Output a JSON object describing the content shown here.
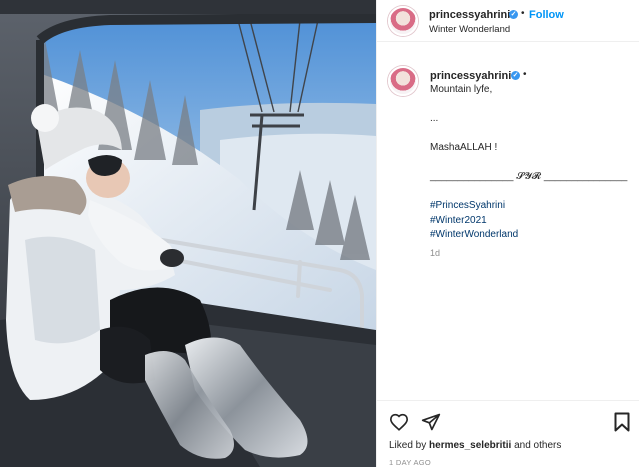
{
  "post": {
    "username": "princessyahrini",
    "follow_label": "Follow",
    "location": "Winter Wonderland",
    "verified_mark": "✓",
    "separator": "•"
  },
  "caption": {
    "username": "princessyahrini",
    "lines": {
      "l1": "Mountain lyfe,",
      "l2": "...",
      "l3": "MashaALLAH !",
      "l4": "_______________ 𝓢𝓨𝓡 _______________"
    },
    "hashtags": [
      "#PrincesSyahrini",
      "#Winter2021",
      "#WinterWonderland"
    ],
    "age": "1d"
  },
  "footer": {
    "liked_prefix": "Liked by ",
    "liked_user": "hermes_selebritii",
    "liked_suffix": " and others",
    "timestamp": "1 DAY AGO"
  },
  "icons": {
    "like": "heart-icon",
    "share": "paper-plane-icon",
    "save": "bookmark-icon",
    "verified": "verified-badge-icon"
  },
  "colors": {
    "accent": "#0095f6",
    "hashtag": "#00376b",
    "verified": "#3897f0",
    "muted": "#8e8e8e"
  }
}
